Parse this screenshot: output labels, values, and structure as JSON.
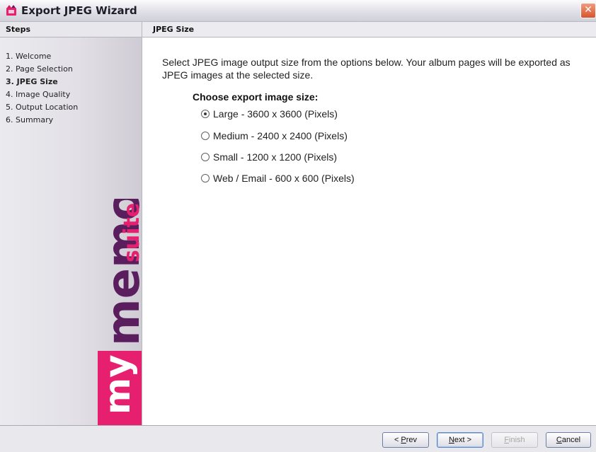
{
  "window": {
    "title": "Export JPEG Wizard",
    "close_symbol": "✕"
  },
  "sidebar": {
    "header": "Steps",
    "steps": [
      {
        "label": "1. Welcome",
        "active": false
      },
      {
        "label": "2. Page Selection",
        "active": false
      },
      {
        "label": "3. JPEG Size",
        "active": true
      },
      {
        "label": "4. Image Quality",
        "active": false
      },
      {
        "label": "5. Output Location",
        "active": false
      },
      {
        "label": "6. Summary",
        "active": false
      }
    ],
    "brand": {
      "my": "my",
      "memories": "memories",
      "suite": "suite",
      "colors": {
        "pink": "#e6206f",
        "purple": "#5a1e5e",
        "light_pink": "#f25f9a"
      }
    }
  },
  "main": {
    "header": "JPEG Size",
    "description": "Select JPEG image output size from the options below. Your album pages will be exported as JPEG images at the selected size.",
    "choose_label": "Choose export image size:",
    "options": [
      {
        "label": "Large - 3600 x 3600 (Pixels)",
        "selected": true
      },
      {
        "label": "Medium - 2400 x 2400 (Pixels)",
        "selected": false
      },
      {
        "label": "Small - 1200 x 1200 (Pixels)",
        "selected": false
      },
      {
        "label": "Web / Email - 600 x 600 (Pixels)",
        "selected": false
      }
    ]
  },
  "buttons": {
    "prev": {
      "prefix": "< ",
      "mnemonic": "P",
      "rest": "rev"
    },
    "next": {
      "mnemonic": "N",
      "rest": "ext >"
    },
    "finish": {
      "mnemonic": "F",
      "rest": "inish",
      "enabled": false
    },
    "cancel": {
      "mnemonic": "C",
      "rest": "ancel"
    }
  }
}
